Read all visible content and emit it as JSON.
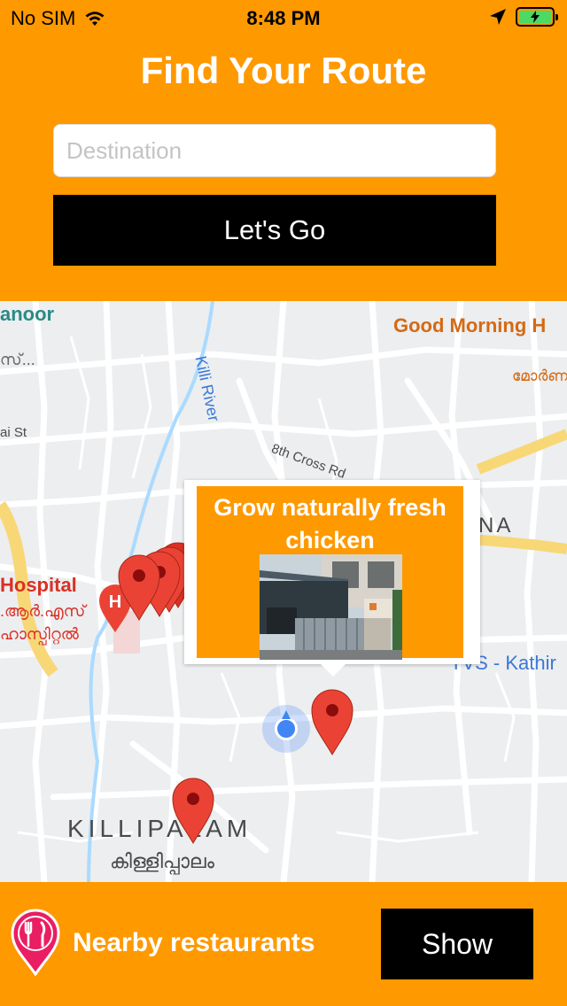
{
  "status": {
    "carrier": "No SIM",
    "time": "8:48 PM",
    "icons": [
      "wifi-icon",
      "location-arrow-icon",
      "battery-charging-icon"
    ]
  },
  "header": {
    "title": "Find Your Route",
    "destination_placeholder": "Destination",
    "destination_value": "",
    "go_label": "Let's Go"
  },
  "map": {
    "labels": {
      "anoor": "anoor",
      "malayalam_top_left": "സ്...",
      "good_morning": "Good Morning H",
      "killi_river": "Killi River",
      "malayalam_top_right": "മോർണ",
      "hi_st": "ai St",
      "cross_rd": "8th Cross Rd",
      "na": "NA",
      "hospital": "Hospital",
      "hospital_ml_1": ".ആർ.എസ്",
      "hospital_ml_2": "ഹാസ്പിറ്റൽ",
      "tvs": "TVS - Kathir",
      "killipalam": "KILLIPALAM",
      "killipalam_ml": "കിള്ളിപ്പാലം"
    },
    "callout": {
      "title": "Grow naturally fresh chicken",
      "image": "shop-photo"
    }
  },
  "bottom": {
    "icon": "restaurant-pin-icon",
    "label": "Nearby restaurants",
    "show_label": "Show"
  },
  "colors": {
    "accent": "#ff9900",
    "button": "#000000",
    "pin": "#ea4335",
    "user_location": "#4285f4",
    "restaurant_icon": "#e91e63"
  }
}
